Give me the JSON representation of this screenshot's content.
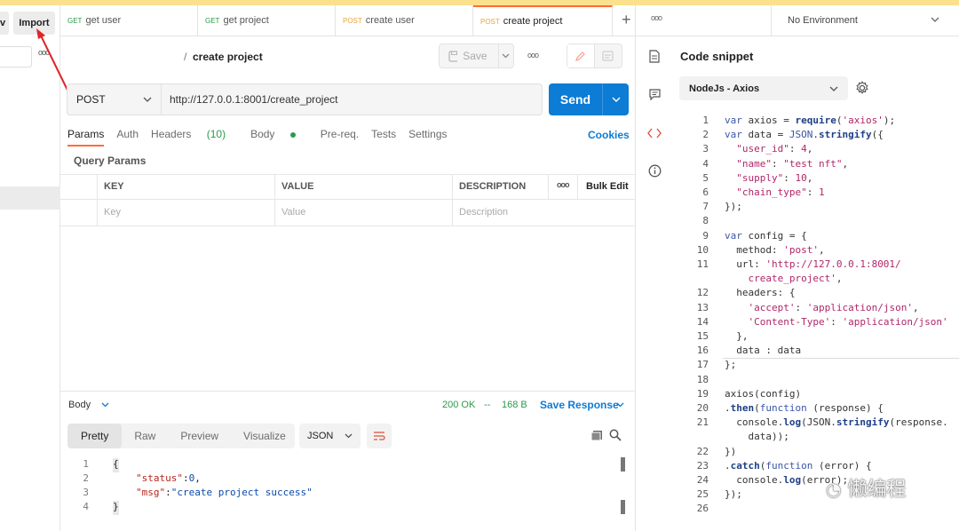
{
  "sidebar": {
    "buttons": [
      "v",
      "Import"
    ],
    "more": "ooo"
  },
  "tabs": [
    {
      "method": "GET",
      "label": "get user"
    },
    {
      "method": "GET",
      "label": "get project"
    },
    {
      "method": "POST",
      "label": "create user"
    },
    {
      "method": "POST",
      "label": "create project"
    }
  ],
  "tab_actions": {
    "add": "+",
    "more": "ooo"
  },
  "environment": {
    "selected": "No Environment"
  },
  "request": {
    "breadcrumb_sep": "/",
    "name": "create project",
    "save_label": "Save",
    "more": "ooo",
    "method": "POST",
    "url": "http://127.0.0.1:8001/create_project",
    "send_label": "Send"
  },
  "subtabs": [
    {
      "label": "Params"
    },
    {
      "label": "Auth"
    },
    {
      "label": "Headers",
      "count": "(10)"
    },
    {
      "label": "Body"
    },
    {
      "label": "Pre-req."
    },
    {
      "label": "Tests"
    },
    {
      "label": "Settings"
    }
  ],
  "cookies_label": "Cookies",
  "query_params": {
    "title": "Query Params",
    "columns": [
      "KEY",
      "VALUE",
      "DESCRIPTION",
      "ooo",
      "Bulk Edit"
    ],
    "placeholders": [
      "Key",
      "Value",
      "Description"
    ]
  },
  "response": {
    "label": "Body",
    "status": "200 OK",
    "sep": "--",
    "size": "168 B",
    "save_label": "Save Response",
    "view_tabs": [
      "Pretty",
      "Raw",
      "Preview",
      "Visualize"
    ],
    "format": "JSON",
    "lines": [
      {
        "n": "1",
        "text": "{"
      },
      {
        "n": "2",
        "key": "\"status\"",
        "val": "0",
        "tail": ","
      },
      {
        "n": "3",
        "key": "\"msg\"",
        "val": "\"create project success\"",
        "tail": ""
      },
      {
        "n": "4",
        "text": "}"
      }
    ]
  },
  "snippet": {
    "title": "Code snippet",
    "language": "NodeJs - Axios",
    "code": [
      {
        "n": "1",
        "html": "<span class='kw'>var</span> axios = <span class='fn'>require</span>(<span class='str'>'axios'</span>);"
      },
      {
        "n": "2",
        "html": "<span class='kw'>var</span> data = <span class='kw'>JSON</span>.<span class='fn'>stringify</span>({"
      },
      {
        "n": "3",
        "html": "  <span class='str'>\"user_id\"</span>: <span class='num'>4</span>,"
      },
      {
        "n": "4",
        "html": "  <span class='str'>\"name\"</span>: <span class='str'>\"test nft\"</span>,"
      },
      {
        "n": "5",
        "html": "  <span class='str'>\"supply\"</span>: <span class='num'>10</span>,"
      },
      {
        "n": "6",
        "html": "  <span class='str'>\"chain_type\"</span>: <span class='num'>1</span>"
      },
      {
        "n": "7",
        "html": "});"
      },
      {
        "n": "8",
        "html": ""
      },
      {
        "n": "9",
        "html": "<span class='kw'>var</span> config = {"
      },
      {
        "n": "10",
        "html": "  method: <span class='str'>'post'</span>,"
      },
      {
        "n": "11",
        "html": "  url: <span class='str'>'http://127.0.0.1:8001/</span>"
      },
      {
        "n": "",
        "html": "    <span class='str'>create_project'</span>,"
      },
      {
        "n": "12",
        "html": "  headers: {"
      },
      {
        "n": "13",
        "html": "    <span class='str'>'accept'</span>: <span class='str'>'application/json'</span>,"
      },
      {
        "n": "14",
        "html": "    <span class='str'>'Content-Type'</span>: <span class='str'>'application/json'</span>"
      },
      {
        "n": "15",
        "html": "  },"
      },
      {
        "n": "16",
        "html": "  data : data"
      },
      {
        "n": "17",
        "html": "};"
      },
      {
        "n": "18",
        "html": ""
      },
      {
        "n": "19",
        "html": "axios(config)"
      },
      {
        "n": "20",
        "html": ".<span class='fn'>then</span>(<span class='kw'>function</span> (response) {"
      },
      {
        "n": "21",
        "html": "  console.<span class='fn'>log</span>(JSON.<span class='fn'>stringify</span>(response."
      },
      {
        "n": "",
        "html": "    data));"
      },
      {
        "n": "22",
        "html": "})"
      },
      {
        "n": "23",
        "html": ".<span class='fn'>catch</span>(<span class='kw'>function</span> (error) {"
      },
      {
        "n": "24",
        "html": "  console.<span class='fn'>log</span>(error);"
      },
      {
        "n": "25",
        "html": "});"
      },
      {
        "n": "26",
        "html": ""
      }
    ]
  },
  "watermark": "懒编程",
  "colors": {
    "accent": "#ff6c37",
    "send": "#0c7cd5",
    "top_strip": "#fbe18e"
  }
}
